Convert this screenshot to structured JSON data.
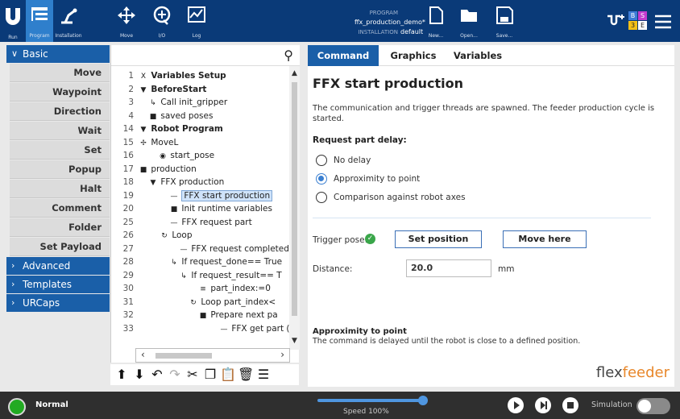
{
  "header": {
    "nav": [
      {
        "label": "Run"
      },
      {
        "label": "Program"
      },
      {
        "label": "Installation"
      },
      {
        "label": "Move"
      },
      {
        "label": "I/O"
      },
      {
        "label": "Log"
      }
    ],
    "program_key": "PROGRAM",
    "program_value": "ffx_production_demo*",
    "installation_key": "INSTALLATION",
    "installation_value": "default",
    "file": [
      {
        "label": "New..."
      },
      {
        "label": "Open..."
      },
      {
        "label": "Save..."
      }
    ],
    "badges": {
      "b": "B",
      "s": "S",
      "three": "3",
      "e": "E"
    }
  },
  "left": {
    "basic_label": "Basic",
    "commands": [
      "Move",
      "Waypoint",
      "Direction",
      "Wait",
      "Set",
      "Popup",
      "Halt",
      "Comment",
      "Folder",
      "Set Payload"
    ],
    "categories": [
      "Advanced",
      "Templates",
      "URCaps"
    ]
  },
  "tree": {
    "rows": [
      {
        "num": "1",
        "icon": "X",
        "text": "Variables Setup"
      },
      {
        "num": "2",
        "icon": "▼",
        "text": "BeforeStart"
      },
      {
        "num": "3",
        "icon": "↳",
        "text": "Call init_gripper"
      },
      {
        "num": "4",
        "icon": "■",
        "text": "saved poses"
      },
      {
        "num": "14",
        "icon": "▼",
        "text": "Robot Program"
      },
      {
        "num": "15",
        "icon": "✢",
        "text": "MoveL"
      },
      {
        "num": "16",
        "icon": "◉",
        "text": "start_pose"
      },
      {
        "num": "17",
        "icon": "■",
        "text": "production"
      },
      {
        "num": "18",
        "icon": "▼",
        "text": "FFX production"
      },
      {
        "num": "19",
        "icon": "—",
        "text": "FFX start production"
      },
      {
        "num": "20",
        "icon": "■",
        "text": "Init runtime variables"
      },
      {
        "num": "25",
        "icon": "—",
        "text": "FFX request part"
      },
      {
        "num": "26",
        "icon": "↻",
        "text": "Loop"
      },
      {
        "num": "27",
        "icon": "—",
        "text": "FFX request completed"
      },
      {
        "num": "28",
        "icon": "↳",
        "text": "If request_done== True"
      },
      {
        "num": "29",
        "icon": "↳",
        "text": "If request_result== T"
      },
      {
        "num": "30",
        "icon": "≡",
        "text": "part_index:=0"
      },
      {
        "num": "31",
        "icon": "↻",
        "text": "Loop part_index<"
      },
      {
        "num": "32",
        "icon": "■",
        "text": "Prepare next pa"
      },
      {
        "num": "33",
        "icon": "—",
        "text": "FFX get part ("
      }
    ]
  },
  "right": {
    "tabs": [
      "Command",
      "Graphics",
      "Variables"
    ],
    "title": "FFX start production",
    "description": "The communication and trigger threads are spawned. The feeder production cycle is started.",
    "delay_label": "Request part delay:",
    "options": [
      "No delay",
      "Approximity to point",
      "Comparison against robot axes"
    ],
    "selected_option": "Approximity to point",
    "trigger_label": "Trigger pose:",
    "set_position": "Set position",
    "move_here": "Move here",
    "distance_label": "Distance:",
    "distance_value": "20.0",
    "distance_unit": "mm",
    "footer_title": "Approximity to point",
    "footer_text": "The command is delayed until the robot is close to a defined position.",
    "logo_left": "flex",
    "logo_right": "feeder"
  },
  "bottom": {
    "status": "Normal",
    "speed": "Speed 100%",
    "speed_fraction": 1.0,
    "simulation": "Simulation"
  }
}
